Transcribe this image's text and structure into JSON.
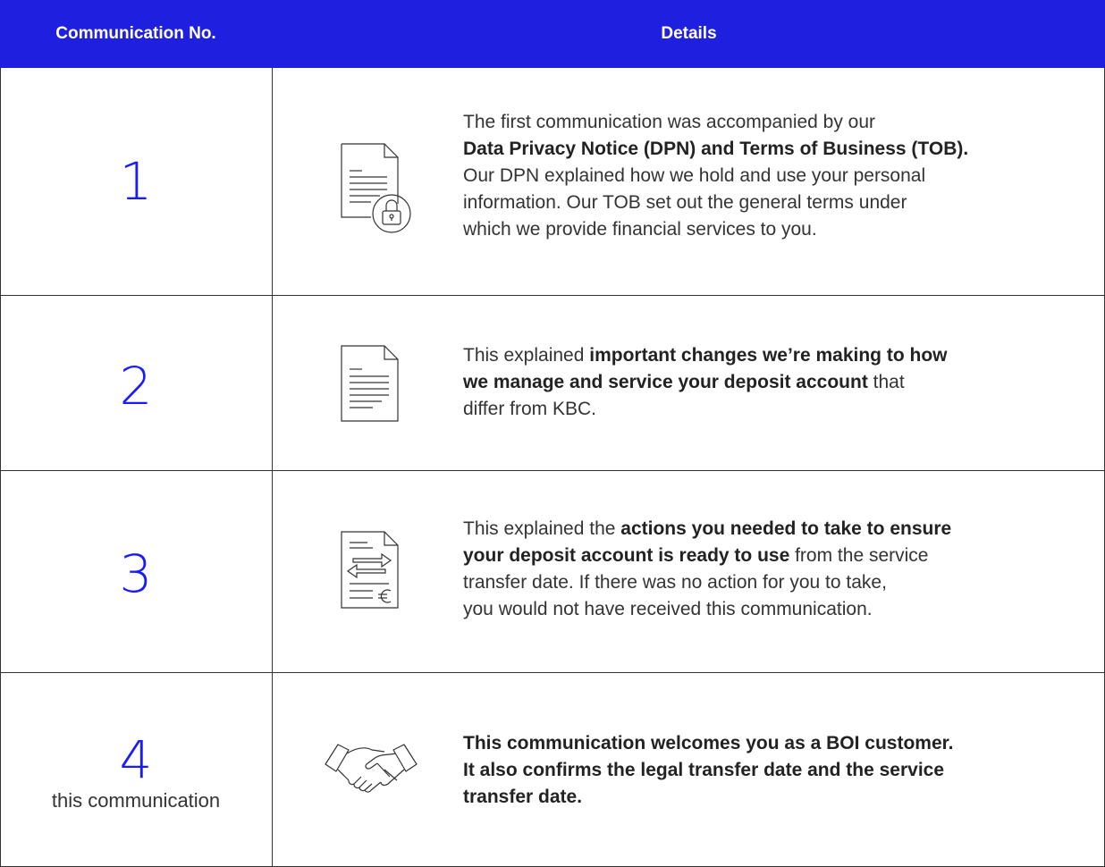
{
  "header": {
    "col1": "Communication No.",
    "col2": "Details"
  },
  "rows": [
    {
      "number": "1",
      "icon": "document-lock-icon",
      "text": {
        "p1": "The first communication was accompanied by our",
        "bold1": "Data Privacy Notice (DPN) and Terms of Business (TOB).",
        "p2": "Our DPN explained how we hold and use your personal",
        "p3": "information. Our TOB set out the general terms under",
        "p4": "which we provide financial services to you."
      }
    },
    {
      "number": "2",
      "icon": "document-icon",
      "text": {
        "pre": "This explained ",
        "bold1": "important changes we’re making to how",
        "bold2": "we manage and service your deposit account",
        "post": " that",
        "p2": "differ from KBC."
      }
    },
    {
      "number": "3",
      "icon": "document-transfer-euro-icon",
      "text": {
        "pre": "This explained the ",
        "bold1": "actions you needed to take to ensure",
        "bold2": "your deposit account is ready to use",
        "post": " from the service",
        "p2": "transfer date. If there was no action for you to take,",
        "p3": "you would not have received this communication."
      }
    },
    {
      "number": "4",
      "sub": "this communication",
      "icon": "handshake-icon",
      "text": {
        "b1": "This communication welcomes you as a BOI customer.",
        "b2": "It also confirms the legal transfer date and the service",
        "b3": "transfer date."
      }
    }
  ],
  "colors": {
    "header_bg": "#1f1fe0",
    "number": "#1a1aff",
    "text": "#333333",
    "border": "#333333"
  }
}
